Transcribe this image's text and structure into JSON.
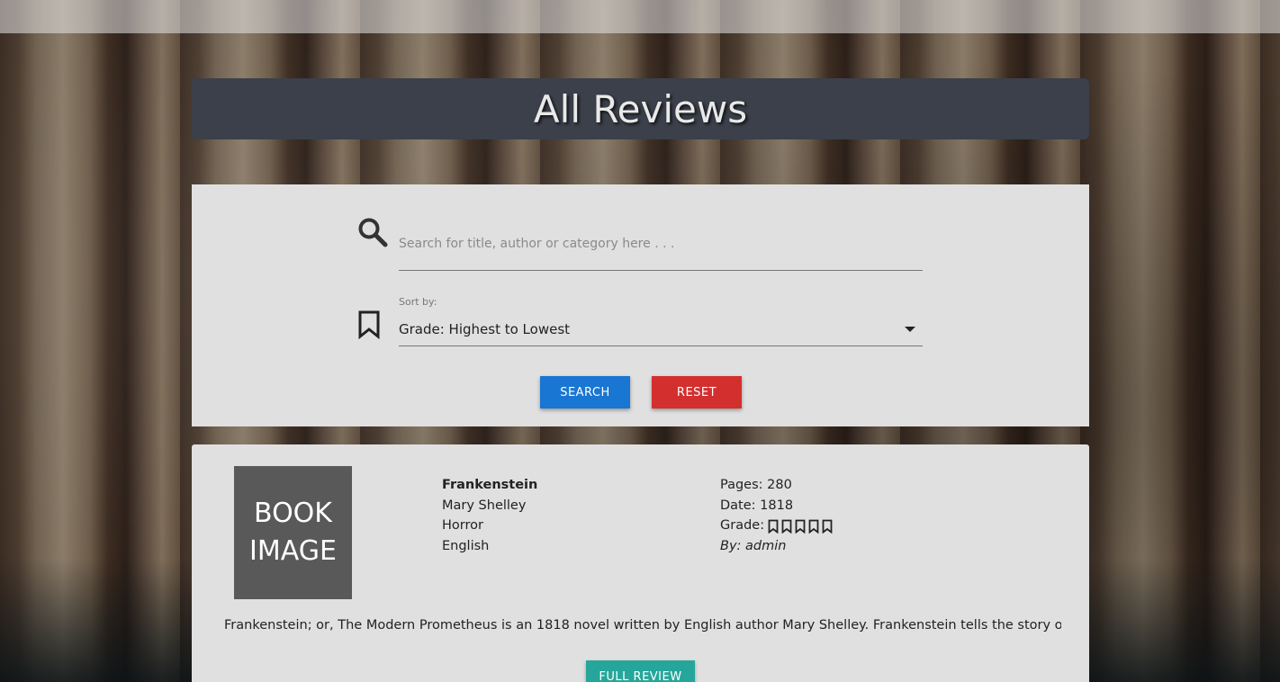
{
  "page": {
    "title": "All Reviews"
  },
  "search": {
    "placeholder": "Search for title, author or category here . . .",
    "value": "",
    "sort_label": "Sort by:",
    "sort_value": "Grade: Highest to Lowest",
    "search_button": "SEARCH",
    "reset_button": "RESET"
  },
  "reviews": [
    {
      "image_text_line1": "BOOK",
      "image_text_line2": "IMAGE",
      "title": "Frankenstein",
      "author": "Mary Shelley",
      "category": "Horror",
      "language": "English",
      "pages": "Pages: 280",
      "date": "Date: 1818",
      "grade_label": "Grade:",
      "grade_max": 5,
      "by": "By: admin",
      "description": "Frankenstein; or, The Modern Prometheus is an 1818 novel written by English author Mary Shelley. Frankenstein tells the story of Victor Fran...",
      "full_review_button": "FULL REVIEW"
    }
  ],
  "colors": {
    "title_bar": "#3b404a",
    "panel": "#e0e0e0",
    "search_button": "#1976d2",
    "reset_button": "#d32f2f",
    "full_review_button": "#26a69a",
    "book_image": "#595959"
  },
  "icons": {
    "search": "search-icon",
    "sort": "bookmark-icon",
    "grade": "bookmark-outline-icon"
  }
}
